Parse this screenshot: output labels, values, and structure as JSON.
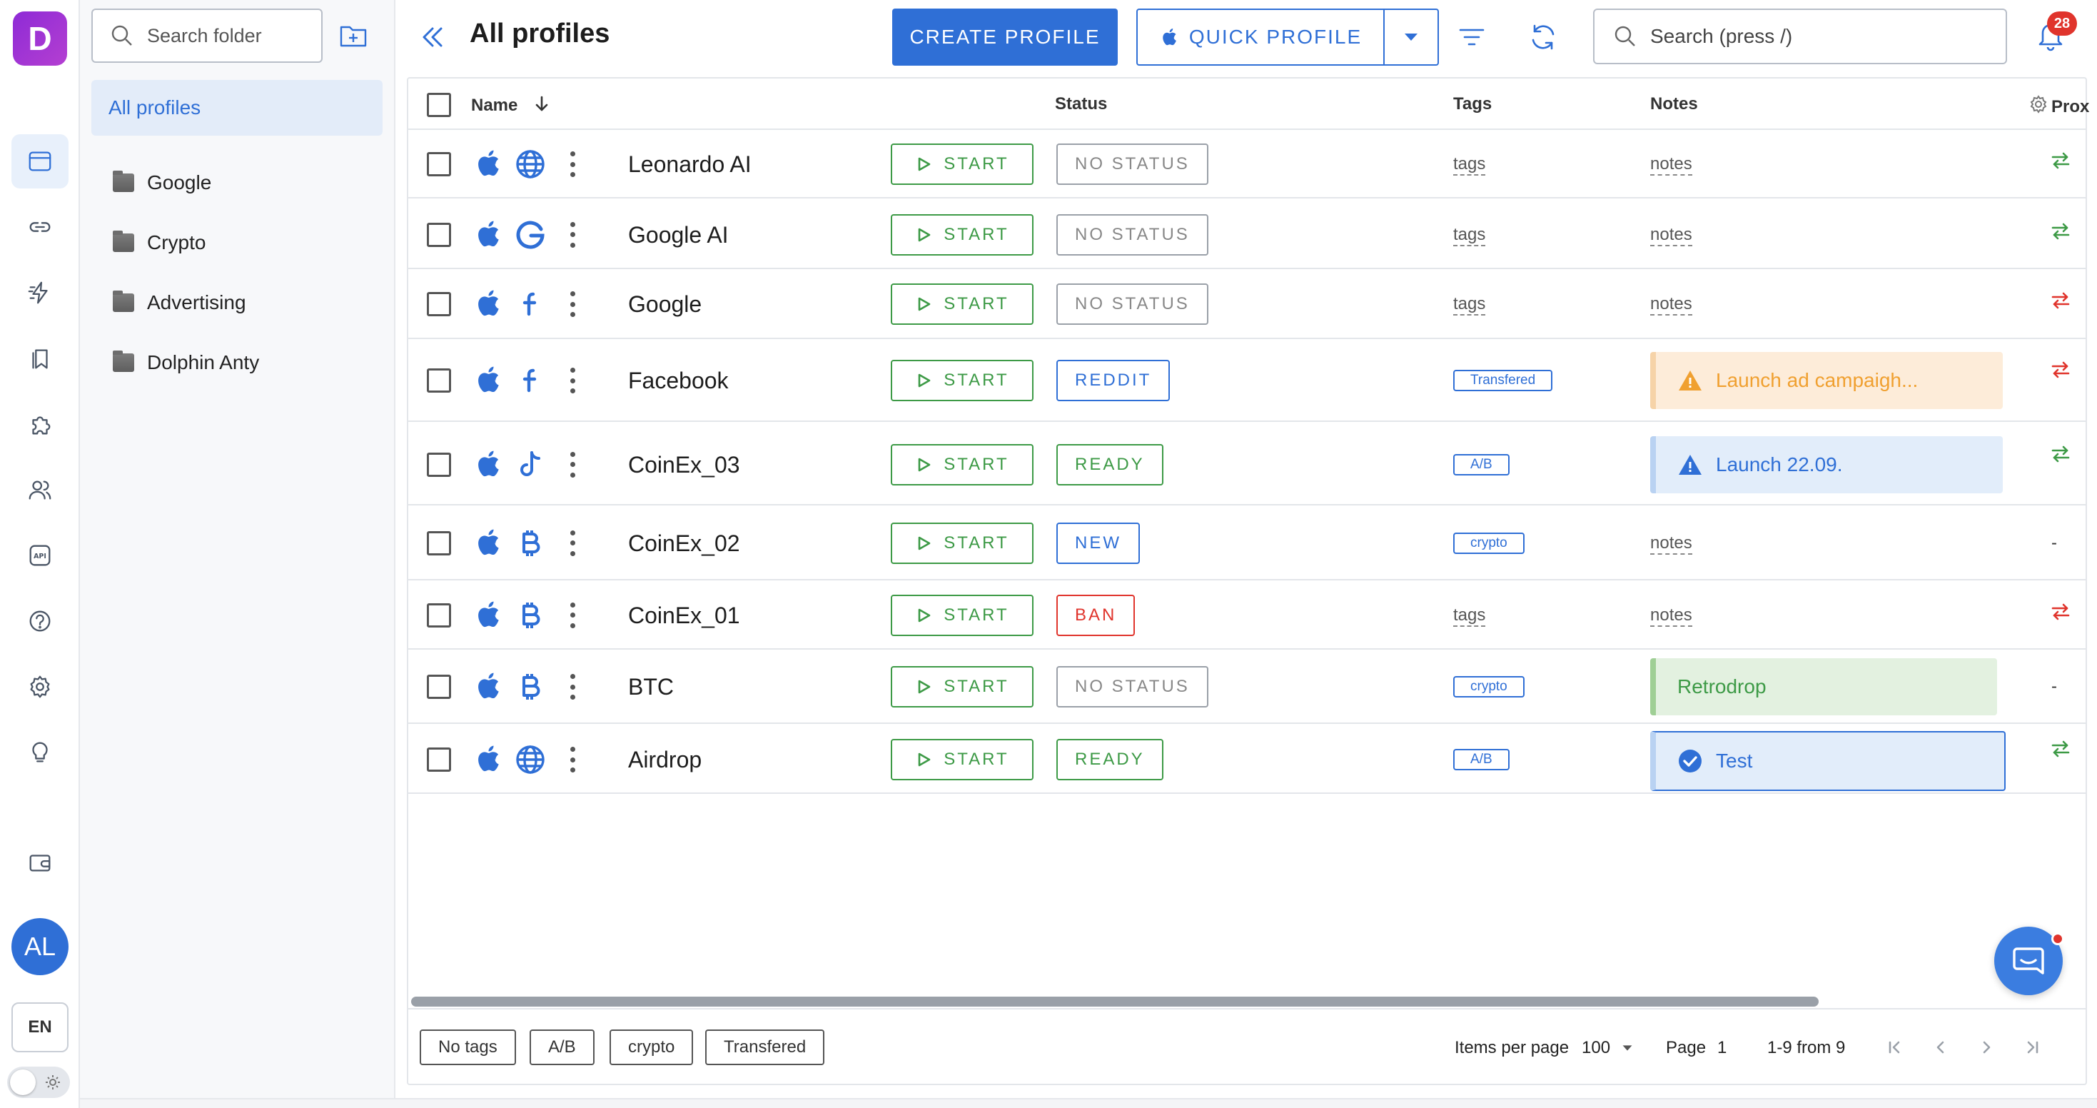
{
  "app": {
    "logo_letter": "D"
  },
  "rail": {
    "items": [
      {
        "name": "profiles-nav",
        "icon": "browser-window-icon",
        "active": true
      },
      {
        "name": "links-nav",
        "icon": "link-icon"
      },
      {
        "name": "automation-nav",
        "icon": "lightning-icon"
      },
      {
        "name": "bookmarks-nav",
        "icon": "bookmark-icon"
      },
      {
        "name": "extensions-nav",
        "icon": "puzzle-icon"
      },
      {
        "name": "team-nav",
        "icon": "users-icon"
      },
      {
        "name": "api-nav",
        "icon": "api-icon"
      },
      {
        "name": "help-nav",
        "icon": "question-icon"
      },
      {
        "name": "settings-nav",
        "icon": "gear-icon"
      },
      {
        "name": "tips-nav",
        "icon": "lightbulb-icon"
      },
      {
        "name": "wallet-nav",
        "icon": "wallet-icon"
      }
    ],
    "avatar": "AL",
    "lang": "EN"
  },
  "folders": {
    "search_placeholder": "Search folder",
    "all_label": "All profiles",
    "items": [
      "Google",
      "Crypto",
      "Advertising",
      "Dolphin Anty"
    ]
  },
  "header": {
    "title": "All profiles",
    "create_label": "CREATE PROFILE",
    "quick_label": "QUICK PROFILE",
    "search_placeholder": "Search (press /)",
    "notifications": "28"
  },
  "table": {
    "columns": {
      "name": "Name",
      "status": "Status",
      "tags": "Tags",
      "notes": "Notes",
      "proxy": "Prox"
    },
    "start_label": "START",
    "rows": [
      {
        "name": "Leonardo AI",
        "site": "globe",
        "status": "NO STATUS",
        "status_kind": "none",
        "tag_text": "tags",
        "tag_kind": "link",
        "note_text": "notes",
        "note_kind": "link",
        "proxy": "green"
      },
      {
        "name": "Google AI",
        "site": "google",
        "status": "NO STATUS",
        "status_kind": "none",
        "tag_text": "tags",
        "tag_kind": "link",
        "note_text": "notes",
        "note_kind": "link",
        "proxy": "green"
      },
      {
        "name": "Google",
        "site": "facebook",
        "status": "NO STATUS",
        "status_kind": "none",
        "tag_text": "tags",
        "tag_kind": "link",
        "note_text": "notes",
        "note_kind": "link",
        "proxy": "red"
      },
      {
        "name": "Facebook",
        "site": "facebook",
        "status": "REDDIT",
        "status_kind": "blue",
        "tag_text": "Transfered",
        "tag_kind": "chip",
        "note_text": "Launch ad campaigh...",
        "note_kind": "warning",
        "proxy": "red"
      },
      {
        "name": "CoinEx_03",
        "site": "tiktok",
        "status": "READY",
        "status_kind": "green",
        "tag_text": "A/B",
        "tag_kind": "chip",
        "note_text": "Launch 22.09.",
        "note_kind": "info",
        "proxy": "green"
      },
      {
        "name": "CoinEx_02",
        "site": "bitcoin",
        "status": "NEW",
        "status_kind": "blue",
        "tag_text": "crypto",
        "tag_kind": "chip",
        "note_text": "notes",
        "note_kind": "link",
        "proxy": "none"
      },
      {
        "name": "CoinEx_01",
        "site": "bitcoin",
        "status": "BAN",
        "status_kind": "red",
        "tag_text": "tags",
        "tag_kind": "link",
        "note_text": "notes",
        "note_kind": "link",
        "proxy": "red"
      },
      {
        "name": "BTC",
        "site": "bitcoin",
        "status": "NO STATUS",
        "status_kind": "none",
        "tag_text": "crypto",
        "tag_kind": "chip",
        "note_text": "Retrodrop",
        "note_kind": "success",
        "proxy": "none"
      },
      {
        "name": "Airdrop",
        "site": "globe",
        "status": "READY",
        "status_kind": "green",
        "tag_text": "A/B",
        "tag_kind": "chip",
        "note_text": "Test",
        "note_kind": "check",
        "proxy": "green"
      }
    ]
  },
  "footer": {
    "tag_filters": [
      "No tags",
      "A/B",
      "crypto",
      "Transfered"
    ],
    "items_per_page_label": "Items per page",
    "items_per_page": "100",
    "page_label": "Page",
    "page": "1",
    "range": "1-9 from 9"
  },
  "colors": {
    "accent": "#2f6fd6",
    "success": "#3d9a46",
    "danger": "#e0342c",
    "warning": "#f0a030"
  }
}
